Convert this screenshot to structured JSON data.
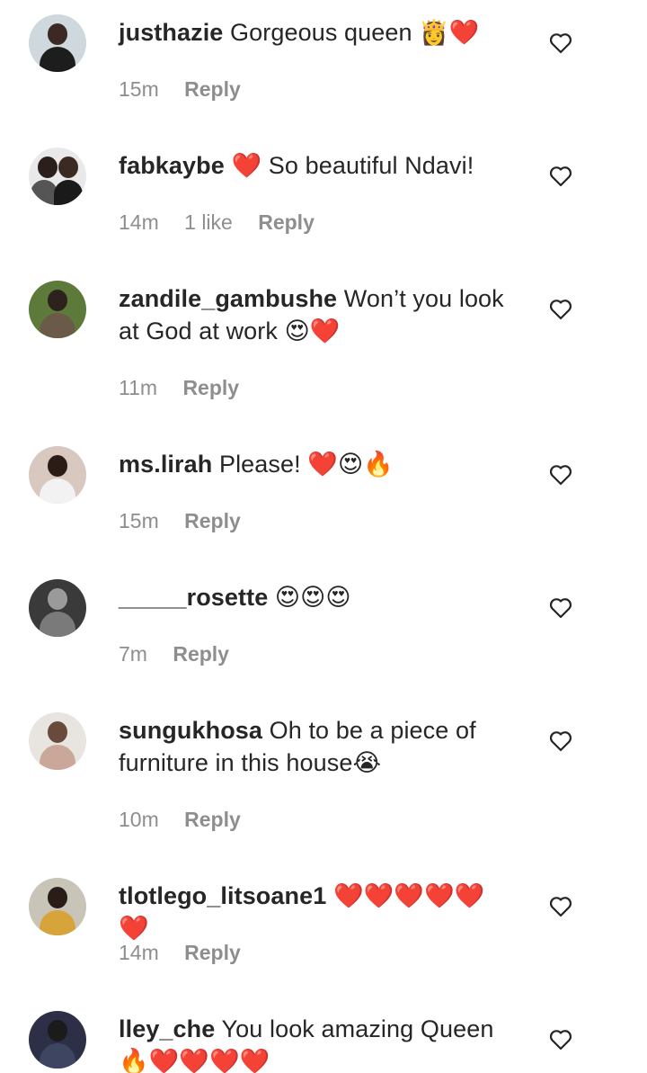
{
  "comments": [
    {
      "username": "justhazie",
      "text": "Gorgeous queen 👸❤️",
      "time": "15m",
      "likes": "",
      "reply": "Reply"
    },
    {
      "username": "fabkaybe",
      "text": "❤️ So beautiful Ndavi!",
      "time": "14m",
      "likes": "1 like",
      "reply": "Reply"
    },
    {
      "username": "zandile_gambushe",
      "text": "Won’t you look at God at work 😍❤️",
      "time": "11m",
      "likes": "",
      "reply": "Reply"
    },
    {
      "username": "ms.lirah",
      "text": "Please! ❤️😍🔥",
      "time": "15m",
      "likes": "",
      "reply": "Reply"
    },
    {
      "username": "_____rosette",
      "text": "😍😍😍",
      "time": "7m",
      "likes": "",
      "reply": "Reply"
    },
    {
      "username": "sungukhosa",
      "text": "Oh to be a piece of furniture in this house😭",
      "time": "10m",
      "likes": "",
      "reply": "Reply"
    },
    {
      "username": "tlotlego_litsoane1",
      "text": "❤️❤️❤️❤️❤️❤️",
      "time": "14m",
      "likes": "",
      "reply": "Reply"
    },
    {
      "username": "lley_che",
      "text": "You look amazing Queen 🔥❤️❤️❤️❤️",
      "time": "",
      "likes": "",
      "reply": ""
    }
  ],
  "colors": {
    "text": "#262626",
    "meta": "#8e8e8e",
    "heart_outline": "#262626"
  },
  "icons": {
    "like": "heart-outline-icon"
  }
}
